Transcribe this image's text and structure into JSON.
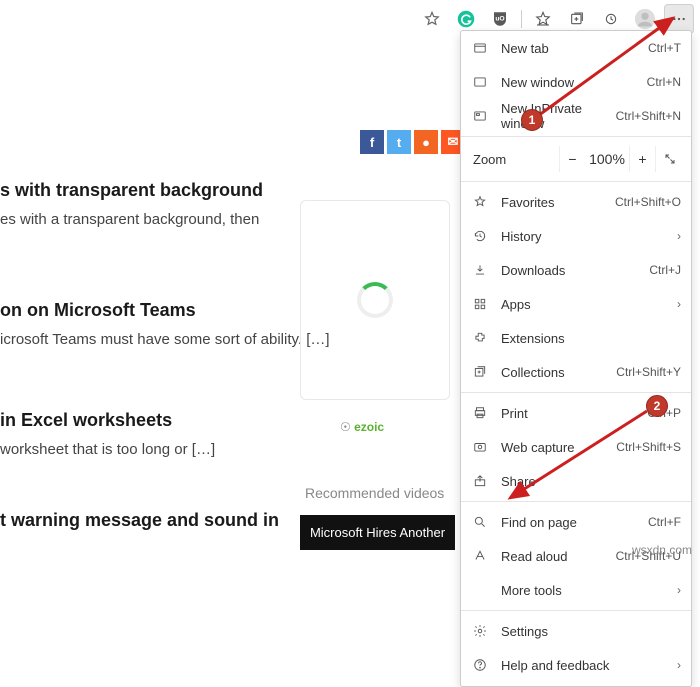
{
  "toolbar": {
    "star": "star-icon",
    "g": "grammarly-icon",
    "shield": "shield-icon",
    "fav": "collections-icon",
    "ext": "extensions-icon",
    "shop": "shopping-icon",
    "avatar": "avatar-icon",
    "more": "more-icon"
  },
  "social": {
    "fb": "f",
    "tw": "t",
    "rss": "●",
    "env": "✉",
    "yt": "▶"
  },
  "sections": {
    "h1": "s with transparent background",
    "t1": "es with a transparent background, then",
    "h2": "on on Microsoft Teams",
    "t2": "icrosoft Teams must have some sort of ability. […]",
    "h3": "in Excel worksheets",
    "t3": "worksheet that is too long or […]",
    "h4": "t warning message and sound in"
  },
  "ezoic": "ezoic",
  "recvid": "Recommended videos",
  "vidcap": "Microsoft Hires Another",
  "menu": {
    "newtab": {
      "label": "New tab",
      "sc": "Ctrl+T"
    },
    "newwin": {
      "label": "New window",
      "sc": "Ctrl+N"
    },
    "inpriv": {
      "label": "New InPrivate window",
      "sc": "Ctrl+Shift+N"
    },
    "zoom": {
      "label": "Zoom",
      "level": "100%"
    },
    "fav": {
      "label": "Favorites",
      "sc": "Ctrl+Shift+O"
    },
    "history": {
      "label": "History"
    },
    "downloads": {
      "label": "Downloads",
      "sc": "Ctrl+J"
    },
    "apps": {
      "label": "Apps"
    },
    "extensions": {
      "label": "Extensions"
    },
    "collections": {
      "label": "Collections",
      "sc": "Ctrl+Shift+Y"
    },
    "print": {
      "label": "Print",
      "sc": "Ctrl+P"
    },
    "capture": {
      "label": "Web capture",
      "sc": "Ctrl+Shift+S"
    },
    "share": {
      "label": "Share"
    },
    "find": {
      "label": "Find on page",
      "sc": "Ctrl+F"
    },
    "read": {
      "label": "Read aloud",
      "sc": "Ctrl+Shift+U"
    },
    "moretools": {
      "label": "More tools"
    },
    "settings": {
      "label": "Settings"
    },
    "help": {
      "label": "Help and feedback"
    }
  },
  "badges": {
    "one": "1",
    "two": "2"
  },
  "watermark": "wsxdn.com"
}
